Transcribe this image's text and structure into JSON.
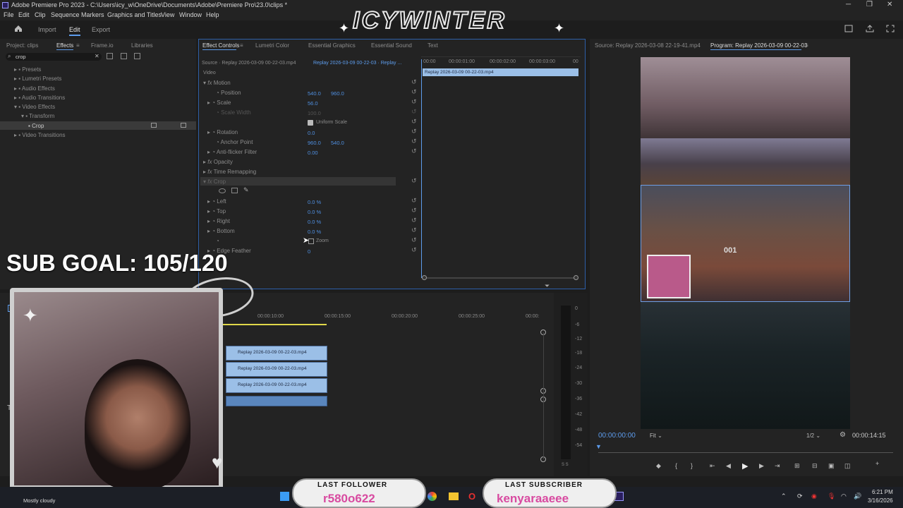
{
  "window": {
    "title": "Adobe Premiere Pro 2023 - C:\\Users\\icy_w\\OneDrive\\Documents\\Adobe\\Premiere Pro\\23.0\\clips *"
  },
  "menu": [
    "File",
    "Edit",
    "Clip",
    "Sequence",
    "Markers",
    "Graphics and Titles",
    "View",
    "Window",
    "Help"
  ],
  "workspace": {
    "import": "Import",
    "edit": "Edit",
    "export": "Export"
  },
  "effects_panel": {
    "tabs": [
      "Project: clips",
      "Effects",
      "Frame.io",
      "Libraries"
    ],
    "search_value": "crop",
    "tree": [
      "Presets",
      "Lumetri Presets",
      "Audio Effects",
      "Audio Transitions",
      "Video Effects",
      "Transform",
      "Crop",
      "Video Transitions"
    ]
  },
  "effect_controls": {
    "tabs": [
      "Effect Controls",
      "Lumetri Color",
      "Essential Graphics",
      "Essential Sound",
      "Text"
    ],
    "source_label": "Source · Replay 2026-03-09 00-22-03.mp4",
    "sequence_label": "Replay 2026-03-09 00-22-03 · Replay ...",
    "section": "Video",
    "timecodes": [
      "00:00",
      "00:00:01:00",
      "00:00:02:00",
      "00:00:03:00",
      "00"
    ],
    "clip_name": "Replay 2026-03-09 00-22-03.mp4",
    "motion": "Motion",
    "position_label": "Position",
    "position_x": "540.0",
    "position_y": "960.0",
    "scale_label": "Scale",
    "scale_value": "56.0",
    "scale_width_label": "Scale Width",
    "scale_width_value": "100.0",
    "uniform_scale": "Uniform Scale",
    "rotation_label": "Rotation",
    "rotation_value": "0.0",
    "anchor_label": "Anchor Point",
    "anchor_x": "960.0",
    "anchor_y": "540.0",
    "antiflicker_label": "Anti-flicker Filter",
    "antiflicker_value": "0.00",
    "opacity": "Opacity",
    "time_remapping": "Time Remapping",
    "crop": "Crop",
    "left_label": "Left",
    "left_value": "0.0 %",
    "top_label": "Top",
    "top_value": "0.0 %",
    "right_label": "Right",
    "right_value": "0.0 %",
    "bottom_label": "Bottom",
    "bottom_value": "0.0 %",
    "zoom_label": "Zoom",
    "edge_label": "Edge Feather",
    "edge_value": "0"
  },
  "monitor": {
    "source_tab": "Source: Replay 2026-03-08 22-19-41.mp4",
    "program_tab": "Program: Replay 2026-03-09 00-22-03",
    "timecode": "00:00:00:00",
    "fit": "Fit",
    "ratio": "1/2",
    "duration": "00:00:14:15"
  },
  "timeline": {
    "timecodes": [
      "00:00:10:00",
      "00:00:15:00",
      "00:00:20:00",
      "00:00:25:00",
      "00:00:"
    ],
    "clips": [
      "Replay 2026-03-09 00-22-03.mp4",
      "Replay 2026-03-09 00-22-03.mp4",
      "Replay 2026-03-09 00-22-03.mp4"
    ],
    "meter_labels": [
      "0",
      "-6",
      "-12",
      "-18",
      "-24",
      "-30",
      "-36",
      "-42",
      "-48",
      "-54"
    ],
    "meter_s": "S S"
  },
  "overlay": {
    "brand": "ICYWINTER",
    "sub_goal": "SUB GOAL: 105/120",
    "last_follower_label": "LAST FOLLOWER",
    "last_follower": "r580o622",
    "last_subscriber_label": "LAST SUBSCRIBER",
    "last_subscriber": "kenyaraaeee"
  },
  "taskbar": {
    "weather": "Mostly cloudy",
    "time": "6:21 PM",
    "date": "3/16/2026"
  },
  "colors": {
    "accent": "#5d9cec",
    "clip": "#9bbfe7",
    "bg": "#1d1d1d"
  }
}
